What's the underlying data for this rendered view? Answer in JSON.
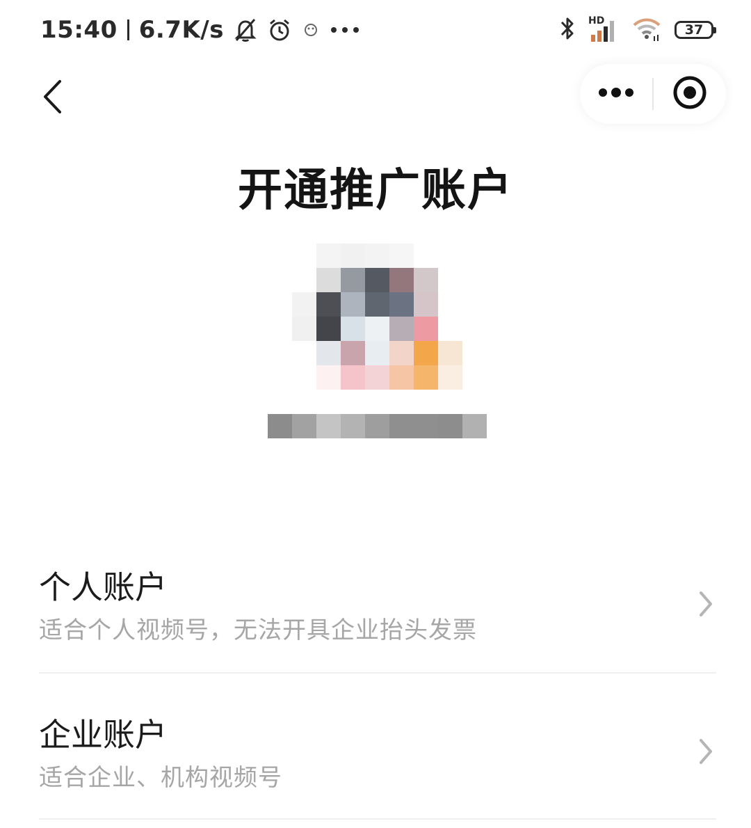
{
  "status_bar": {
    "time": "15:40",
    "net_speed": "6.7K/s",
    "battery": "37",
    "signal_label": "HD"
  },
  "nav": {
    "back_icon": "chevron-left-icon",
    "more_icon": "more-dots-icon",
    "close_icon": "target-close-icon"
  },
  "page": {
    "title": "开通推广账户"
  },
  "options": [
    {
      "title": "个人账户",
      "description": "适合个人视频号，无法开具企业抬头发票"
    },
    {
      "title": "企业账户",
      "description": "适合企业、机构视频号"
    }
  ],
  "avatar_pixels": [
    "#ffffff",
    "#f4f4f4",
    "#f1f1f1",
    "#f3f3f3",
    "#f6f6f6",
    "#ffffff",
    "#ffffff",
    "#ffffff",
    "#dcdcdd",
    "#959aa1",
    "#555961",
    "#93777c",
    "#d2c7c9",
    "#ffffff",
    "#f2f2f2",
    "#4d4f55",
    "#aeb4bd",
    "#5f6670",
    "#6b7282",
    "#d5c4c8",
    "#ffffff",
    "#f0f0f0",
    "#43454b",
    "#d8e0e8",
    "#eef1f4",
    "#b7aeb5",
    "#ee9aa3",
    "#ffffff",
    "#ffffff",
    "#e3e6ea",
    "#c9a4ad",
    "#e8edf1",
    "#f2d5c8",
    "#f4a64a",
    "#f7e6d4",
    "#ffffff",
    "#fdf1f2",
    "#f5c3ca",
    "#f3d3d5",
    "#f6c5a6",
    "#f5b56a",
    "#faeee2"
  ],
  "name_pixels": [
    "#8c8c8c",
    "#a2a2a2",
    "#c4c4c4",
    "#b3b3b3",
    "#9e9e9e",
    "#8f8f8f",
    "#8f8f8f",
    "#8d8d8d",
    "#b1b1b1"
  ]
}
